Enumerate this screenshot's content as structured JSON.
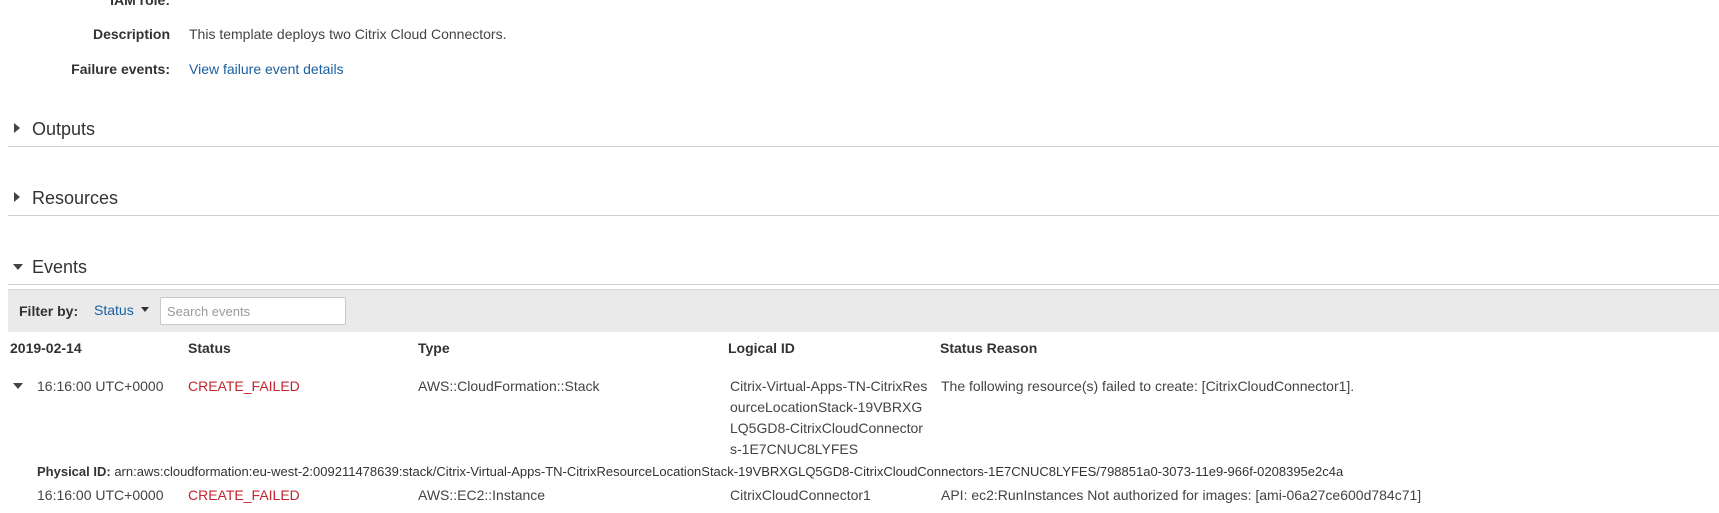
{
  "details": {
    "iam_role_label": "IAM role:",
    "description_label": "Description",
    "description_value": "This template deploys two Citrix Cloud Connectors.",
    "failure_events_label": "Failure events:",
    "failure_events_link": "View failure event details"
  },
  "sections": {
    "outputs": "Outputs",
    "resources": "Resources",
    "events": "Events"
  },
  "filter": {
    "label": "Filter by:",
    "dropdown": "Status",
    "search_placeholder": "Search events"
  },
  "table": {
    "headers": {
      "date": "2019-02-14",
      "status": "Status",
      "type": "Type",
      "logical_id": "Logical ID",
      "status_reason": "Status Reason"
    },
    "rows": [
      {
        "time": "16:16:00 UTC+0000",
        "status": "CREATE_FAILED",
        "type": "AWS::CloudFormation::Stack",
        "logical_id_lines": [
          "Citrix-Virtual-Apps-TN-CitrixRes",
          "ourceLocationStack-19VBRXG",
          "LQ5GD8-CitrixCloudConnector",
          "s-1E7CNUC8LYFES"
        ],
        "status_reason": "The following resource(s) failed to create: [CitrixCloudConnector1].",
        "physical_id_label": "Physical ID:",
        "physical_id": "arn:aws:cloudformation:eu-west-2:009211478639:stack/Citrix-Virtual-Apps-TN-CitrixResourceLocationStack-19VBRXGLQ5GD8-CitrixCloudConnectors-1E7CNUC8LYFES/798851a0-3073-11e9-966f-0208395e2c4a"
      },
      {
        "time": "16:16:00 UTC+0000",
        "status": "CREATE_FAILED",
        "type": "AWS::EC2::Instance",
        "logical_id": "CitrixCloudConnector1",
        "status_reason": "API: ec2:RunInstances Not authorized for images: [ami-06a27ce600d784c71]"
      }
    ]
  }
}
